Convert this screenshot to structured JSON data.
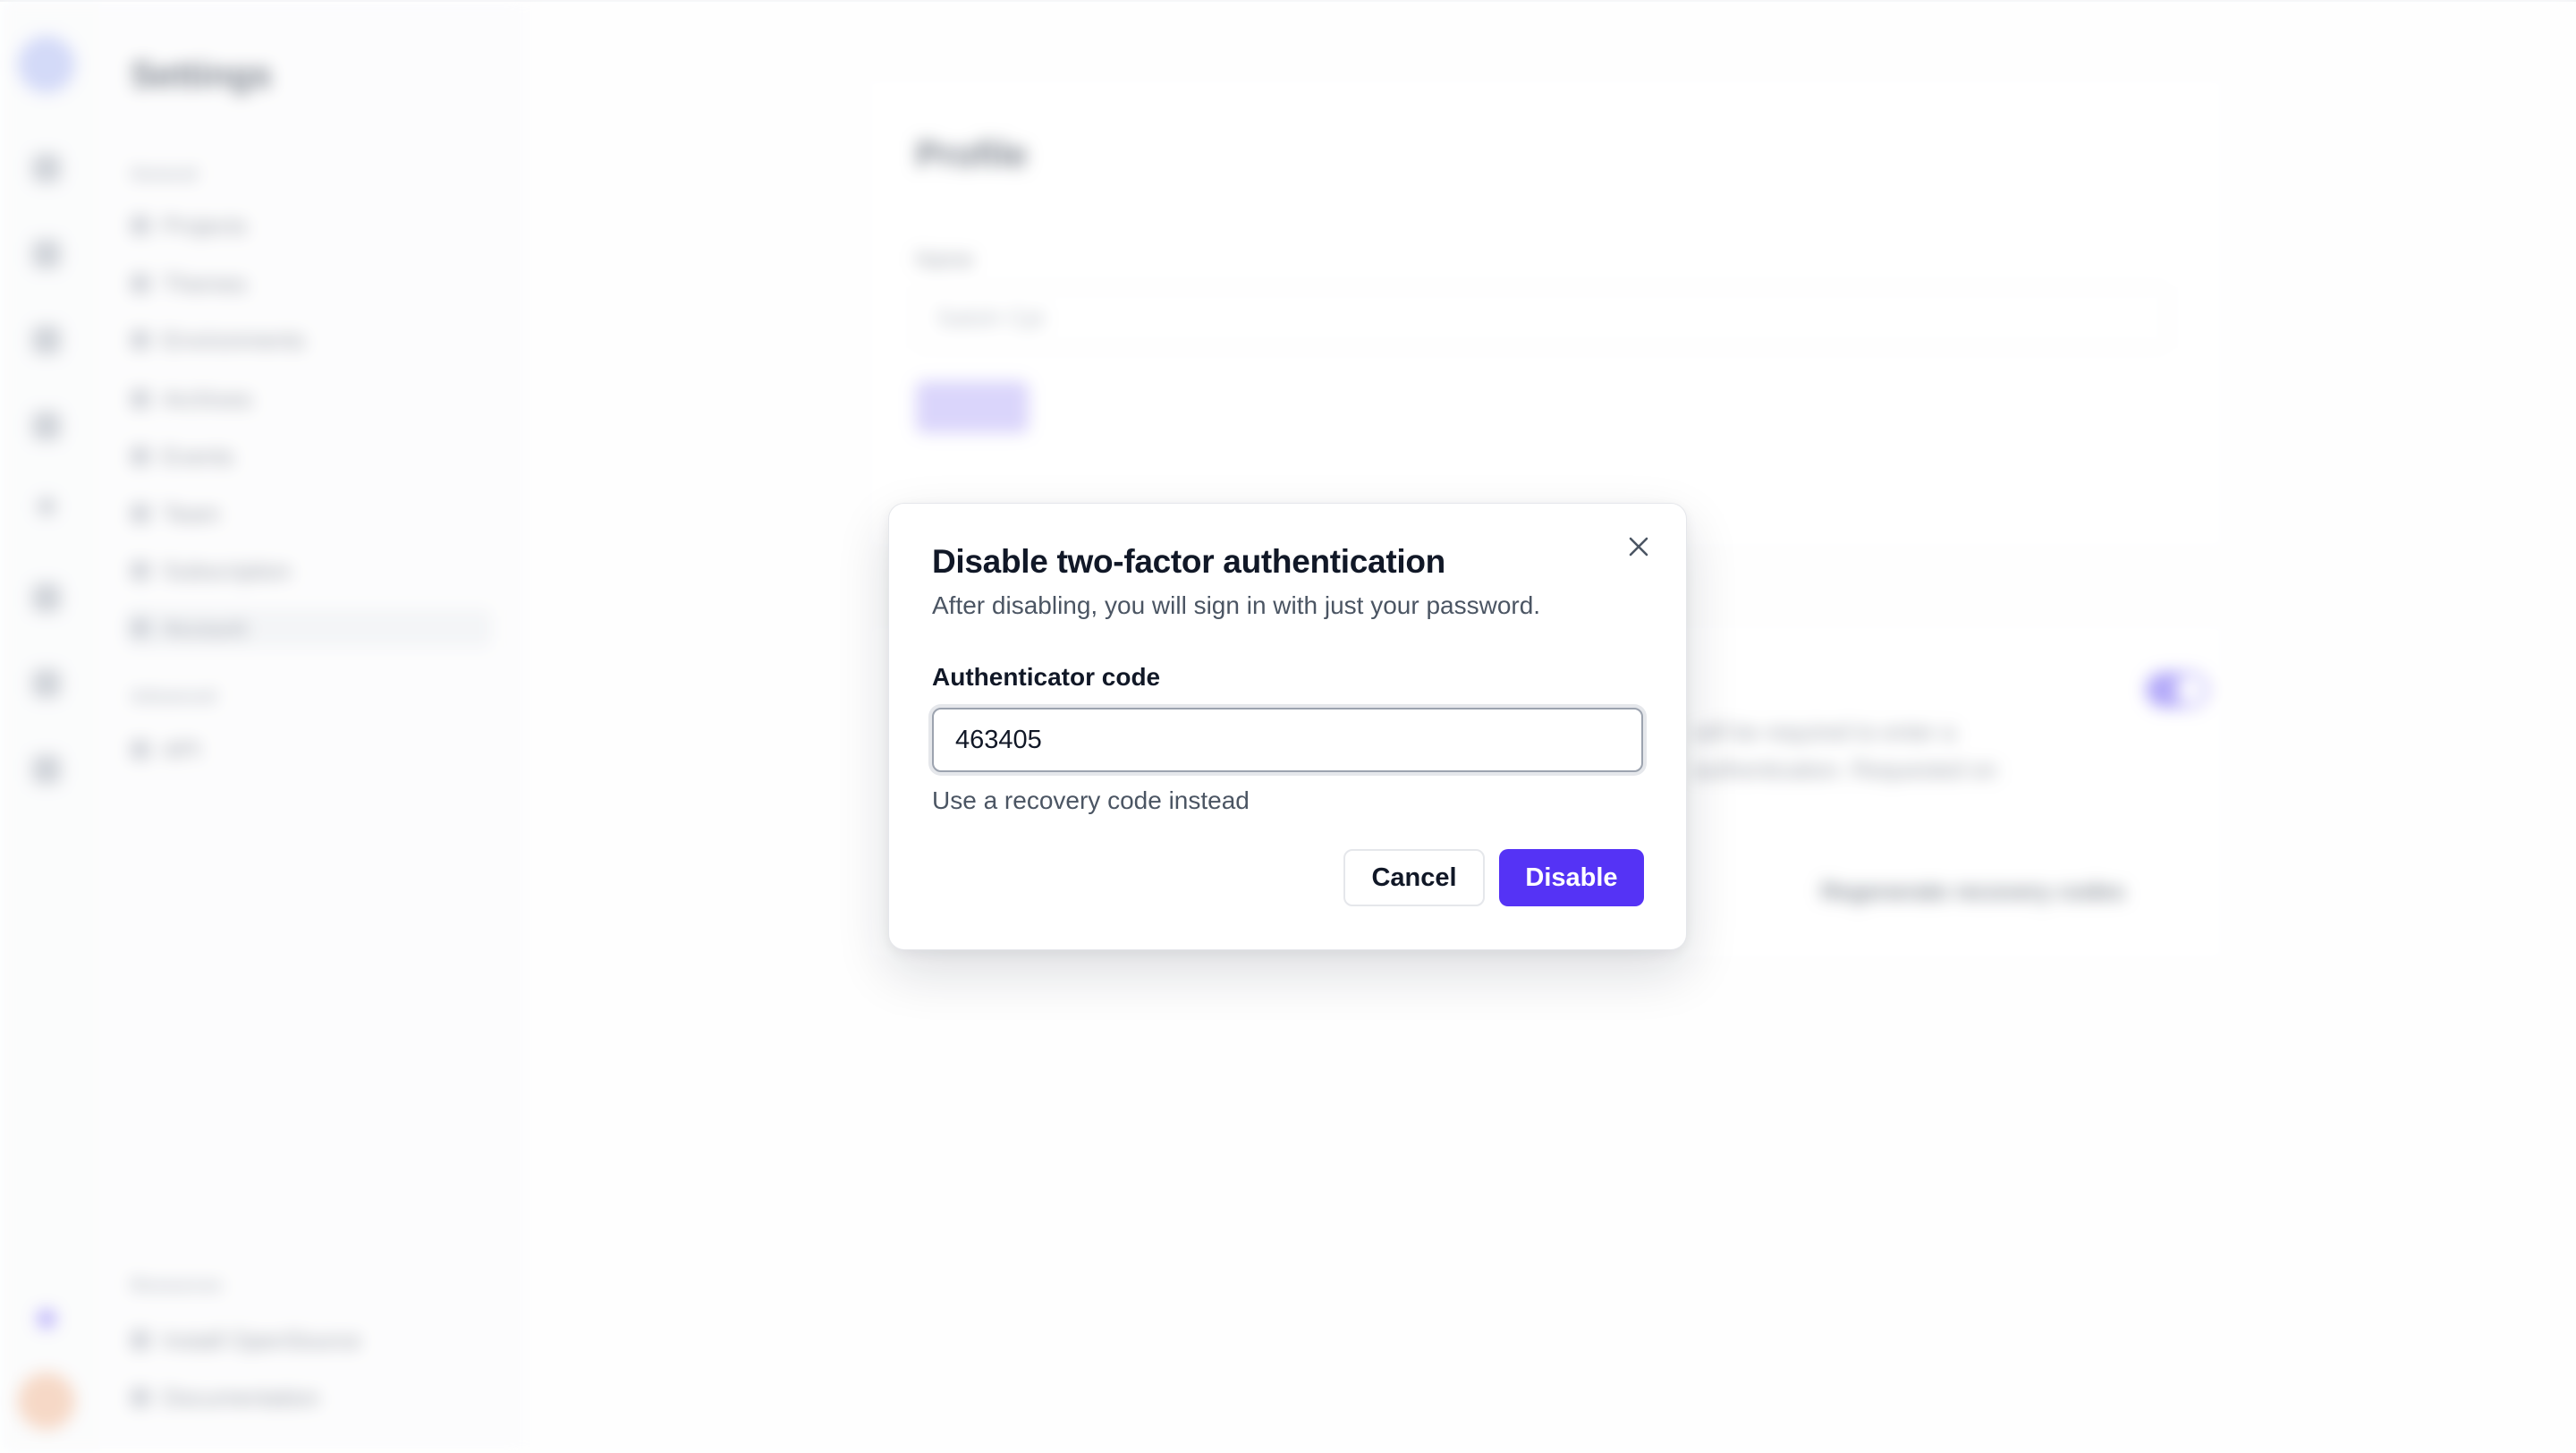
{
  "background": {
    "nav_title": "Settings",
    "nav_section_1": "General",
    "nav_items": [
      "Projects",
      "Themes",
      "Environments",
      "Archives",
      "Events",
      "Team",
      "Subscription",
      "Account"
    ],
    "nav_section_2": "Advanced",
    "nav_items_2": [
      "API"
    ],
    "nav_section_3": "Resources",
    "nav_items_3": [
      "Install OpenSource",
      "Documentation"
    ],
    "profile_title": "Profile",
    "profile_label": "Name",
    "profile_placeholder": "Satish Cpt",
    "security_text_1": "will be required to enter a",
    "security_text_2": "authentication. Requested on",
    "regenerate_link": "Regenerate recovery codes",
    "accent_color": "#5533f5"
  },
  "modal": {
    "title": "Disable two-factor authentication",
    "description": "After disabling, you will sign in with just your password.",
    "code_label": "Authenticator code",
    "code_value": "463405",
    "recovery_link": "Use a recovery code instead",
    "cancel_label": "Cancel",
    "disable_label": "Disable",
    "close_icon": "close-icon"
  }
}
